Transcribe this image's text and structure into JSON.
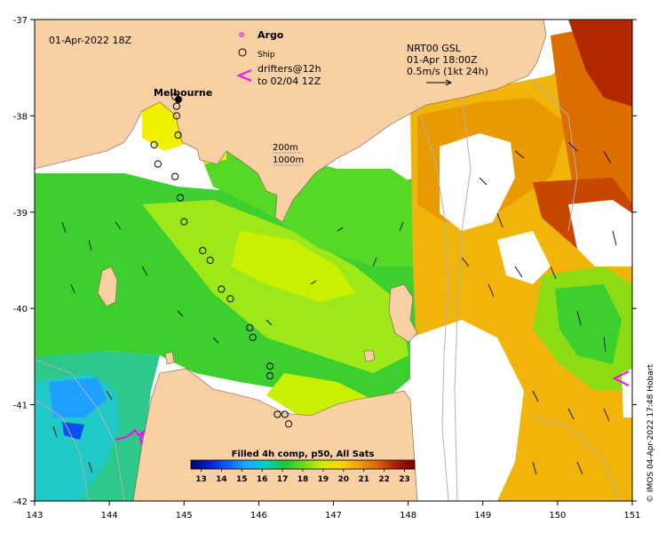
{
  "map": {
    "timestamp": "01-Apr-2022 18Z",
    "city_label": "Melbourne",
    "depth_200": "200m",
    "depth_1000": "1000m",
    "product_line1": "NRT00 GSL",
    "product_line2": "01-Apr 18:00Z",
    "speed_scale": "0.5m/s (1kt 24h)",
    "credit": "© IMOS 04-Apr-2022 17:48 Hobart"
  },
  "legend": {
    "argo_label": "Argo",
    "ship_label": "Ship",
    "drifter_line1": "drifters@12h",
    "drifter_line2": "to 02/04 12Z",
    "argo_color": "#ff00ff",
    "drifter_color": "#ff00ff"
  },
  "axes": {
    "x_ticks": [
      "143",
      "144",
      "145",
      "146",
      "147",
      "148",
      "149",
      "150",
      "151"
    ],
    "y_ticks": [
      "-37",
      "-38",
      "-39",
      "-40",
      "-41",
      "-42"
    ]
  },
  "colorbar": {
    "title": "Filled 4h comp, p50, All Sats",
    "ticks": [
      "13",
      "14",
      "15",
      "16",
      "17",
      "18",
      "19",
      "20",
      "21",
      "22",
      "23"
    ],
    "min": 12.5,
    "max": 23.5,
    "colors": [
      "#00007a",
      "#0020d0",
      "#0a64ff",
      "#20a8ff",
      "#00d2c8",
      "#1ec832",
      "#64dc14",
      "#c8f000",
      "#ffd700",
      "#f0a000",
      "#dc6400",
      "#aa1e00",
      "#7a0000"
    ]
  },
  "ship_track": [
    [
      144.88,
      -37.8
    ],
    [
      144.9,
      -37.9
    ],
    [
      144.9,
      -38.0
    ],
    [
      144.92,
      -38.2
    ],
    [
      144.6,
      -38.3
    ],
    [
      144.65,
      -38.5
    ],
    [
      144.88,
      -38.63
    ],
    [
      144.95,
      -38.85
    ],
    [
      145.0,
      -39.1
    ],
    [
      145.25,
      -39.4
    ],
    [
      145.35,
      -39.5
    ],
    [
      145.5,
      -39.8
    ],
    [
      145.62,
      -39.9
    ],
    [
      145.88,
      -40.2
    ],
    [
      145.92,
      -40.3
    ],
    [
      146.15,
      -40.6
    ],
    [
      146.15,
      -40.7
    ],
    [
      146.25,
      -41.1
    ],
    [
      146.35,
      -41.1
    ],
    [
      146.4,
      -41.2
    ]
  ]
}
